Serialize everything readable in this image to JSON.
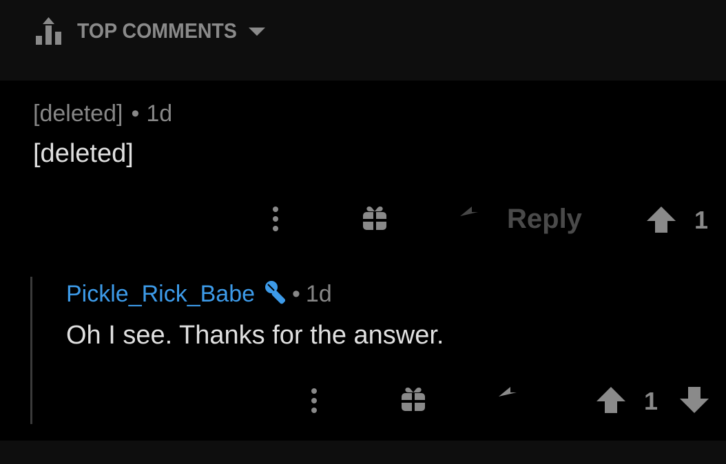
{
  "sort": {
    "label": "TOP COMMENTS",
    "icon": "sort-bars-icon",
    "chevron_icon": "chevron-down-icon"
  },
  "comments": [
    {
      "author": "[deleted]",
      "separator": "•",
      "age": "1d",
      "body": "[deleted]",
      "actions": {
        "more_icon": "more-vertical-icon",
        "award_icon": "gift-icon",
        "reply_icon": "reply-arrow-icon",
        "reply_label": "Reply",
        "upvote_icon": "upvote-arrow-icon",
        "score": "1"
      }
    },
    {
      "author": "Pickle_Rick_Babe",
      "flair_icon": "microphone-icon",
      "separator": "•",
      "age": "1d",
      "body": "Oh I see. Thanks for the answer.",
      "actions": {
        "more_icon": "more-vertical-icon",
        "award_icon": "gift-icon",
        "reply_icon": "reply-arrow-icon",
        "upvote_icon": "upvote-arrow-icon",
        "score": "1",
        "downvote_icon": "downvote-arrow-icon"
      }
    }
  ],
  "colors": {
    "background": "#000000",
    "header_background": "#0e0e0e",
    "username": "#3d9be9",
    "icon_gray": "#8a8a8a",
    "dim_text": "#4a4a4a"
  }
}
